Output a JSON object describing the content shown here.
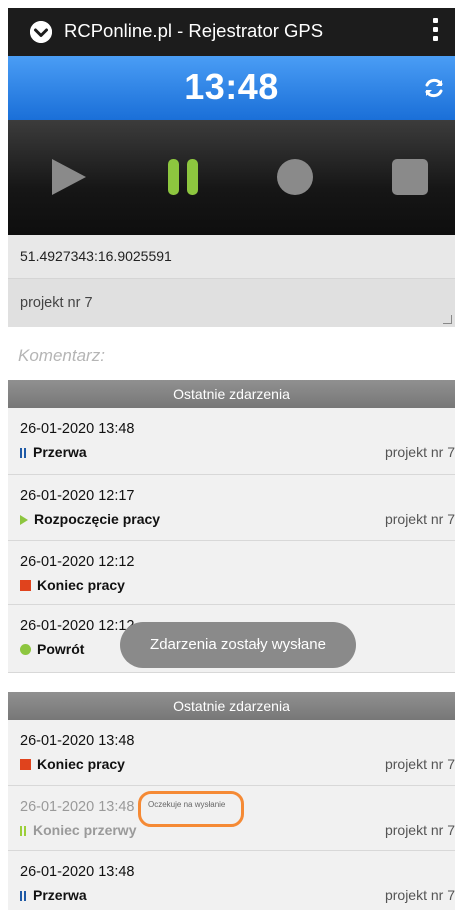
{
  "app": {
    "title": "RCPonline.pl - Rejestrator GPS",
    "clock": "13:48"
  },
  "controls": [
    "play-icon",
    "pause-icon",
    "record-icon",
    "stop-icon"
  ],
  "location": {
    "coordinates": "51.4927343:16.9025591",
    "project": "projekt nr 7",
    "comment_placeholder": "Komentarz:"
  },
  "top_list": {
    "header": "Ostatnie zdarzenia",
    "rows": [
      {
        "date": "26-01-2020 13:48",
        "type": "Przerwa",
        "icon": "pause",
        "project": "projekt nr 7"
      },
      {
        "date": "26-01-2020 12:17",
        "type": "Rozpoczęcie pracy",
        "icon": "play",
        "project": "projekt nr 7"
      },
      {
        "date": "26-01-2020 12:12",
        "type": "Koniec pracy",
        "icon": "stop",
        "project": ""
      },
      {
        "date": "26-01-2020 12:12",
        "type": "Powrót",
        "icon": "dot",
        "project": ""
      }
    ]
  },
  "toast": "Zdarzenia zostały wysłane",
  "bottom_list": {
    "header": "Ostatnie zdarzenia",
    "rows": [
      {
        "date": "26-01-2020 13:48",
        "type": "Koniec pracy",
        "icon": "stop",
        "project": "projekt nr 7"
      },
      {
        "date": "26-01-2020 13:48",
        "type": "Koniec przerwy",
        "icon": "pause-green",
        "project": "projekt nr 7",
        "status": "Oczekuje na wysłanie"
      },
      {
        "date": "26-01-2020 13:48",
        "type": "Przerwa",
        "icon": "pause",
        "project": "projekt nr 7"
      }
    ]
  },
  "colors": {
    "accent_blue": "#1a6fd8",
    "play_inactive": "#8a8a8a",
    "pause_active": "#8dc63f",
    "highlight": "#f58a35"
  }
}
